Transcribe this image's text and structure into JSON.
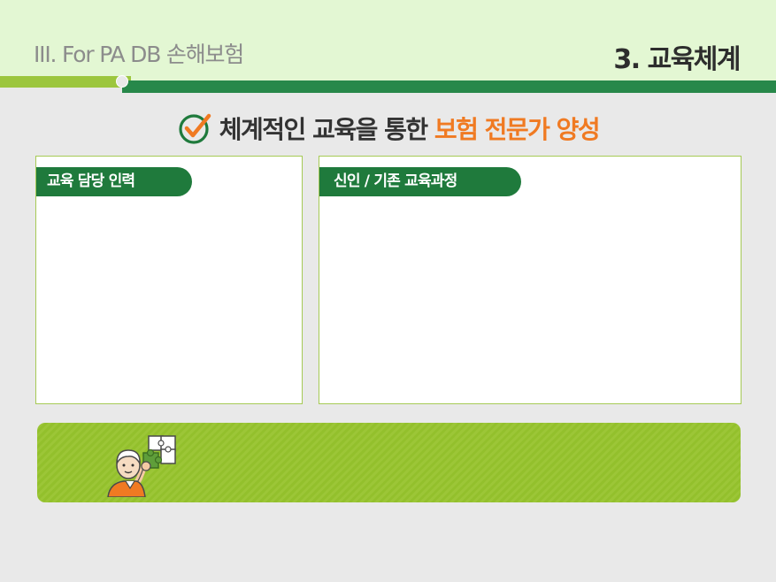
{
  "header": {
    "section_label": "III. For PA DB 손해보험",
    "page_heading": "3. 교육체계"
  },
  "subtitle": {
    "text_normal": "체계적인 교육을 통한 ",
    "text_accent": "보험 전문가 양성",
    "icon": "check-circle-icon"
  },
  "panels": {
    "left": {
      "tag": "교육 담당 인력"
    },
    "right": {
      "tag": "신인 / 기존 교육과정"
    }
  },
  "banner": {
    "icon": "person-holding-puzzle-icon"
  },
  "colors": {
    "header_bg": "#e3f7d3",
    "accent_orange": "#f07a22",
    "dark_green": "#1f7a3c",
    "light_green": "#9cc63e",
    "panel_border": "#a6ca55"
  }
}
